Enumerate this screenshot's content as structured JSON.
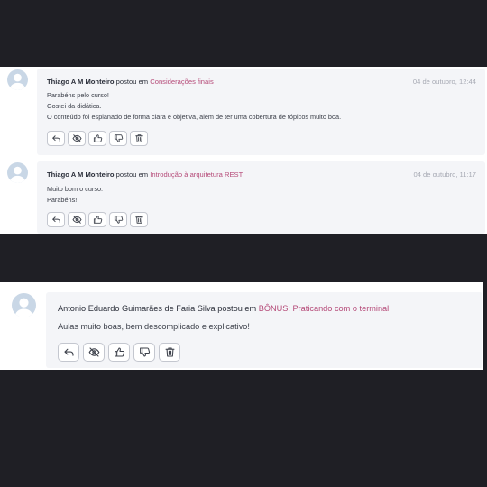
{
  "colors": {
    "background": "#1f1f25",
    "link": "#b54a78",
    "bubble": "#f4f5f8"
  },
  "comments": [
    {
      "author": "Thiago A M Monteiro",
      "posted_in": "postou em",
      "lesson": "Considerações finais",
      "date": "04 de outubro, 12:44",
      "lines": [
        "Parabéns pelo curso!",
        "Gostei da didática.",
        "O conteúdo foi esplanado de forma clara e objetiva, além de ter uma cobertura de tópicos muito boa."
      ]
    },
    {
      "author": "Thiago A M Monteiro",
      "posted_in": "postou em",
      "lesson": "Introdução à arquitetura REST",
      "date": "04 de outubro, 11:17",
      "lines": [
        "Muito bom o curso.",
        "Parabéns!"
      ]
    },
    {
      "author": "Antonio Eduardo Guimarães de Faria Silva",
      "posted_in": "postou em",
      "lesson": "BÔNUS: Praticando com o terminal",
      "lines": [
        "Aulas muito boas, bem descomplicado e explicativo!"
      ]
    }
  ],
  "action_icons": [
    "reply-icon",
    "hide-icon",
    "thumbs-up-icon",
    "thumbs-down-icon",
    "trash-icon"
  ]
}
